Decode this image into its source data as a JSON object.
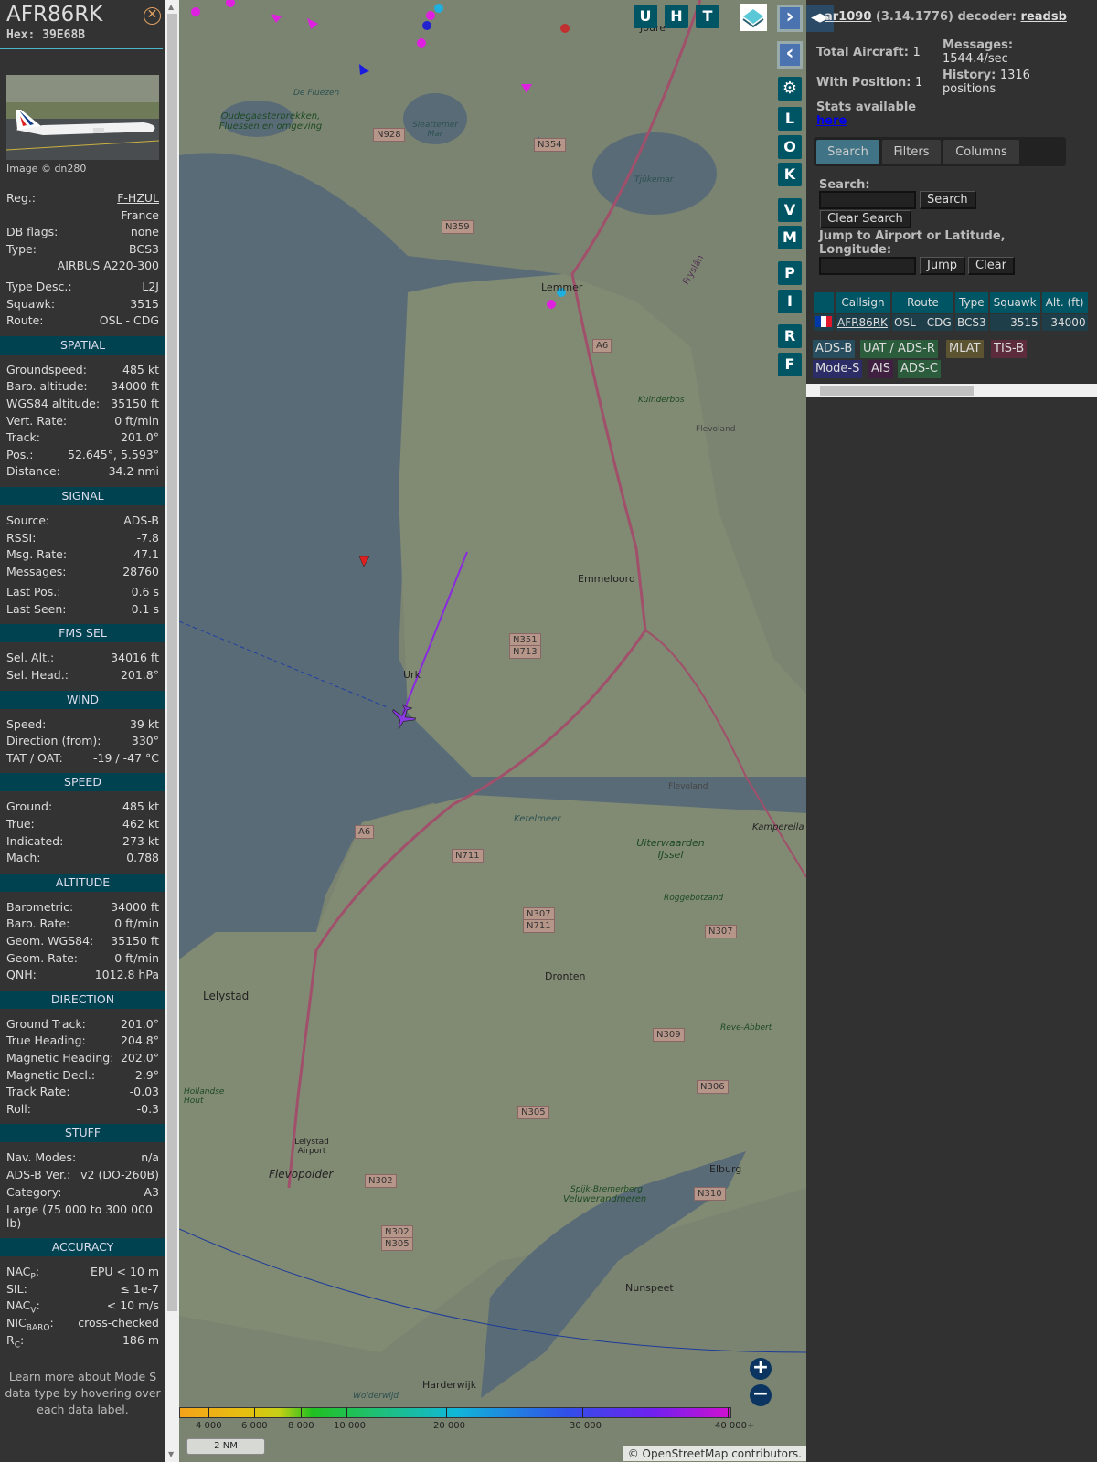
{
  "aircraft": {
    "callsign": "AFR86RK",
    "hex_label": "Hex: 39E68B",
    "photo_credit": "Image © dn280",
    "close_icon": "close-circle-icon"
  },
  "info_rows": [
    {
      "label": "Reg.:",
      "value": "F-HZUL",
      "link": true
    },
    {
      "label": "",
      "value": "France"
    },
    {
      "label": "DB flags:",
      "value": "none"
    },
    {
      "label": "Type:",
      "value": "BCS3"
    },
    {
      "label": "",
      "value": "AIRBUS A220-300"
    },
    {
      "label": "Type Desc.:",
      "value": "L2J",
      "gap": true
    },
    {
      "label": "Squawk:",
      "value": "3515"
    },
    {
      "label": "Route:",
      "value": "OSL - CDG"
    }
  ],
  "sections": [
    {
      "title": "SPATIAL",
      "rows": [
        {
          "label": "Groundspeed:",
          "value": "485 kt"
        },
        {
          "label": "Baro. altitude:",
          "value": "34000 ft"
        },
        {
          "label": "WGS84 altitude:",
          "value": "35150 ft"
        },
        {
          "label": "Vert. Rate:",
          "value": "0 ft/min"
        },
        {
          "label": "Track:",
          "value": "201.0°"
        },
        {
          "label": "Pos.:",
          "value": "52.645°, 5.593°"
        },
        {
          "label": "Distance:",
          "value": "34.2 nmi"
        }
      ]
    },
    {
      "title": "SIGNAL",
      "rows": [
        {
          "label": "Source:",
          "value": "ADS-B"
        },
        {
          "label": "RSSI:",
          "value": "-7.8"
        },
        {
          "label": "Msg. Rate:",
          "value": "47.1"
        },
        {
          "label": "Messages:",
          "value": "28760"
        },
        {
          "label": "Last Pos.:",
          "value": "0.6 s",
          "gap": true
        },
        {
          "label": "Last Seen:",
          "value": "0.1 s"
        }
      ]
    },
    {
      "title": "FMS SEL",
      "rows": [
        {
          "label": "Sel. Alt.:",
          "value": "34016 ft"
        },
        {
          "label": "Sel. Head.:",
          "value": "201.8°"
        }
      ]
    },
    {
      "title": "WIND",
      "rows": [
        {
          "label": "Speed:",
          "value": "39 kt"
        },
        {
          "label": "Direction (from):",
          "value": "330°"
        },
        {
          "label": "TAT / OAT:",
          "value": "-19 / -47 °C"
        }
      ]
    },
    {
      "title": "SPEED",
      "rows": [
        {
          "label": "Ground:",
          "value": "485 kt"
        },
        {
          "label": "True:",
          "value": "462 kt"
        },
        {
          "label": "Indicated:",
          "value": "273 kt"
        },
        {
          "label": "Mach:",
          "value": "0.788"
        }
      ]
    },
    {
      "title": "ALTITUDE",
      "rows": [
        {
          "label": "Barometric:",
          "value": "34000 ft"
        },
        {
          "label": "Baro. Rate:",
          "value": "0 ft/min"
        },
        {
          "label": "Geom. WGS84:",
          "value": "35150 ft"
        },
        {
          "label": "Geom. Rate:",
          "value": "0 ft/min"
        },
        {
          "label": "QNH:",
          "value": "1012.8 hPa"
        }
      ]
    },
    {
      "title": "DIRECTION",
      "rows": [
        {
          "label": "Ground Track:",
          "value": "201.0°"
        },
        {
          "label": "True Heading:",
          "value": "204.8°"
        },
        {
          "label": "Magnetic Heading:",
          "value": "202.0°"
        },
        {
          "label": "Magnetic Decl.:",
          "value": "2.9°"
        },
        {
          "label": "Track Rate:",
          "value": "-0.03"
        },
        {
          "label": "Roll:",
          "value": "-0.3"
        }
      ]
    },
    {
      "title": "STUFF",
      "rows": [
        {
          "label": "Nav. Modes:",
          "value": "n/a"
        },
        {
          "label": "ADS-B Ver.:",
          "value": "v2 (DO-260B)"
        },
        {
          "label": "Category:",
          "value": "A3"
        },
        {
          "label": "Large (75 000 to 300 000 lb)",
          "value": "",
          "wrap": true
        }
      ]
    },
    {
      "title": "ACCURACY",
      "rows": [
        {
          "label": "NAC",
          "sub": "P",
          "value": "EPU < 10 m"
        },
        {
          "label": "SIL:",
          "value": "≤ 1e-7"
        },
        {
          "label": "NAC",
          "sub": "V",
          "value": "< 10 m/s"
        },
        {
          "label": "NIC",
          "sub": "BARO",
          "value": "cross-checked"
        },
        {
          "label": "R",
          "sub": "C",
          "value": "186 m"
        }
      ]
    }
  ],
  "footnote": "Learn more about Mode S data type by hovering over each data label.",
  "map": {
    "top_buttons": [
      "U",
      "H",
      "T"
    ],
    "side_buttons": [
      "L",
      "O",
      "K",
      "V",
      "M",
      "P",
      "I",
      "R",
      "F"
    ],
    "layers_icon": "layers-icon",
    "settings_icon": "gear-icon",
    "altitude_scale": [
      "4 000",
      "6 000",
      "8 000",
      "10 000",
      "20 000",
      "30 000",
      "40 000+"
    ],
    "scale_bar": "2 NM",
    "attribution_prefix": "© ",
    "attribution_link": "OpenStreetMap",
    "attribution_suffix": " contributors.",
    "labels": {
      "lemmer": "Lemmer",
      "emmeloord": "Emmeloord",
      "urk": "Urk",
      "dronten": "Dronten",
      "lelystad": "Lelystad",
      "harderwijk": "Harderwijk",
      "nunspeet": "Nunspeet",
      "elburg": "Elburg",
      "joure": "Joure",
      "flevopolder": "Flevopolder",
      "oudega": "Oudegaasterbrekken, Fluessen en omgeving",
      "fluezen": "De Fluezen",
      "slotermeer": "Sleattemer Mar",
      "tjeukemeer": "Tjûkemar",
      "ketelmeer": "Ketelmeer",
      "uiterwaarden": "Uiterwaarden IJssel",
      "veluwe": "Veluwerandmeren",
      "kampereiland": "Kampereila",
      "kunderbos": "Kuinderbos",
      "flevoland": "Flevoland",
      "fryslan": "Fryslân",
      "airport": "Lelystad Airport",
      "hollandse": "Hollandse Hout",
      "reve": "Reve-Abbert",
      "roggebot": "Roggebotzand",
      "spijk": "Spijk-Bremerberg",
      "wolderwijd": "Wolderwijd"
    },
    "road_shields": [
      "N928",
      "N354",
      "N359",
      "A6",
      "N351",
      "N713",
      "N711",
      "A6",
      "N307",
      "N711",
      "N307",
      "N309",
      "N306",
      "N305",
      "N302",
      "N302",
      "N305",
      "N310"
    ]
  },
  "right": {
    "toggle_icon": "panel-toggle-arrows-icon",
    "app_prefix": "ar1090",
    "version": " (3.14.1776) decoder: ",
    "decoder": "readsb",
    "total_aircraft_label": "Total Aircraft:",
    "total_aircraft": "1",
    "with_position_label": "With Position:",
    "with_position": "1",
    "messages_label": "Messages:",
    "messages": "1544.4/sec",
    "history_label": "History:",
    "history": "1316 positions",
    "stats_label": "Stats available",
    "stats_link": "here",
    "tabs": [
      "Search",
      "Filters",
      "Columns"
    ],
    "search_label": "Search:",
    "search_value": "",
    "search_button": "Search",
    "clear_search_button": "Clear Search",
    "jump_label": "Jump to Airport or Latitude, Longitude:",
    "jump_value": "",
    "jump_button": "Jump",
    "clear_button": "Clear",
    "table": {
      "headers": [
        "",
        "Callsign",
        "Route",
        "Type",
        "Squawk",
        "Alt. (ft)"
      ],
      "rows": [
        {
          "flag": "France",
          "callsign": "AFR86RK",
          "route": "OSL - CDG",
          "type": "BCS3",
          "squawk": "3515",
          "alt": "34000"
        }
      ]
    },
    "legend": [
      {
        "label": "ADS-B",
        "color": "#274d5e"
      },
      {
        "label": "UAT / ADS-R",
        "color": "#2b5c3c"
      },
      {
        "label": "MLAT",
        "color": "#5c5330"
      },
      {
        "label": "TIS-B",
        "color": "#5c2c3c"
      },
      {
        "label": "Mode-S",
        "color": "#2c2c66"
      },
      {
        "label": "AIS",
        "color": "#402040"
      },
      {
        "label": "ADS-C",
        "color": "#2b5c3c"
      }
    ]
  }
}
